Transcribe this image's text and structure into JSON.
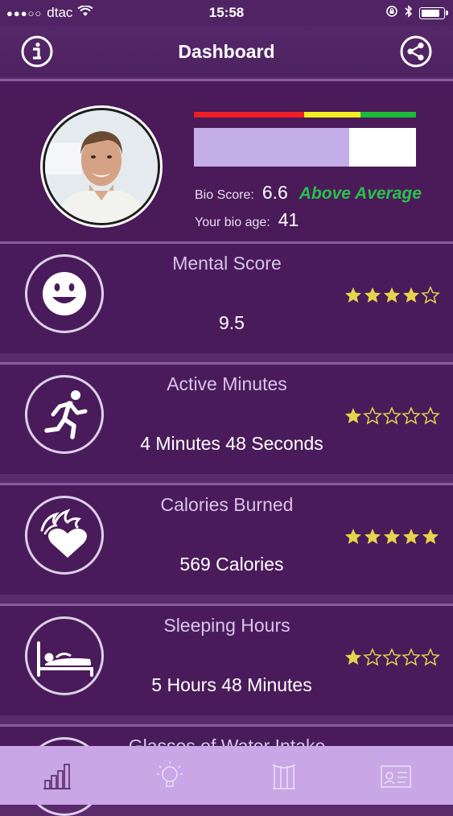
{
  "status": {
    "carrier": "dtac",
    "time": "15:58"
  },
  "nav": {
    "title": "Dashboard"
  },
  "profile": {
    "bio_score_label": "Bio Score:",
    "bio_score_value": "6.6",
    "bio_score_status": "Above Average",
    "bio_age_label": "Your bio age:",
    "bio_age_value": "41",
    "meter_fraction": 0.7
  },
  "metrics": [
    {
      "title": "Mental Score",
      "value": "9.5",
      "stars": 4,
      "icon": "smiley-icon"
    },
    {
      "title": "Active Minutes",
      "value": "4 Minutes  48 Seconds",
      "stars": 1,
      "icon": "running-icon"
    },
    {
      "title": "Calories Burned",
      "value": "569 Calories",
      "stars": 5,
      "icon": "flaming-heart-icon"
    },
    {
      "title": "Sleeping Hours",
      "value": "5 Hours  48 Minutes",
      "stars": 1,
      "icon": "sleeping-icon"
    },
    {
      "title": "Glasses of Water Intake",
      "value": "",
      "stars": 0,
      "icon": "water-icon"
    }
  ],
  "tabs": [
    {
      "icon": "bar-chart-icon",
      "active": true
    },
    {
      "icon": "lightbulb-icon",
      "active": false
    },
    {
      "icon": "body-icon",
      "active": false
    },
    {
      "icon": "id-card-icon",
      "active": false
    }
  ],
  "colors": {
    "background": "#5a2a6b",
    "card": "#4a1b5a",
    "tabbar": "#c9a7e7",
    "star": "#e6d34c",
    "status_good": "#27c24a"
  }
}
